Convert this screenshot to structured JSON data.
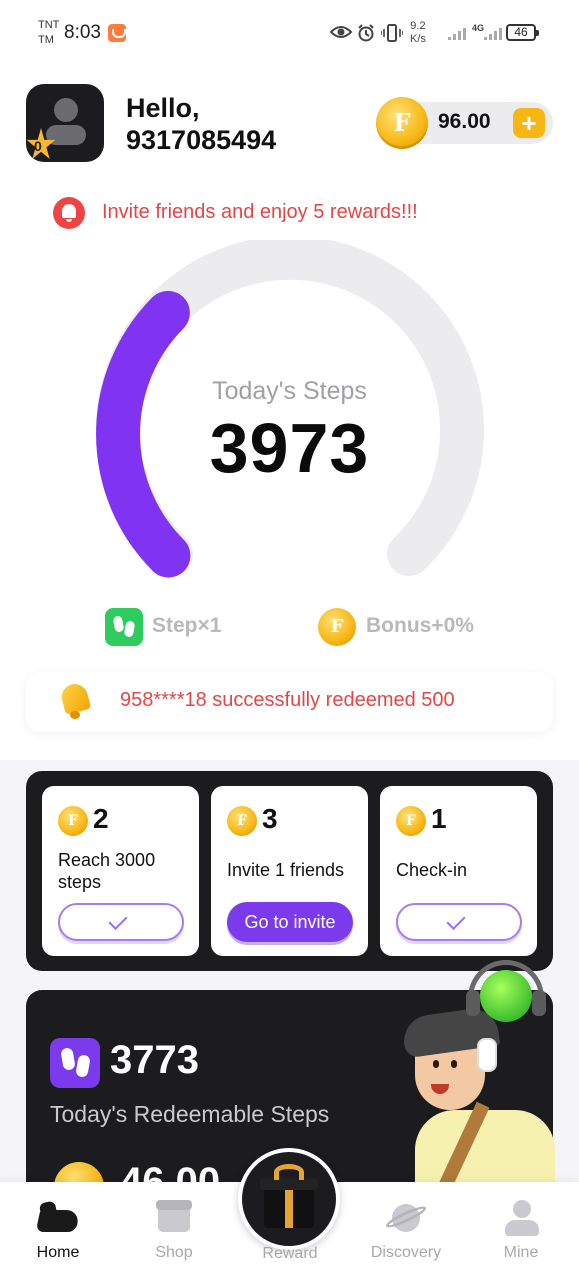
{
  "status_bar": {
    "carrier_top": "TNT",
    "carrier_bottom": "TM",
    "time": "8:03",
    "net_speed_value": "9.2",
    "net_speed_unit": "K/s",
    "network_type": "4G",
    "battery": "46"
  },
  "header": {
    "level": "0",
    "greeting": "Hello,",
    "user_id": "9317085494",
    "coin_letter": "F",
    "coin_balance": "96.00",
    "add_symbol": "+"
  },
  "invite_banner": {
    "text": "Invite friends and enjoy 5 rewards!!!"
  },
  "steps": {
    "label": "Today's Steps",
    "value": "3973",
    "ring_progress_fraction": 0.33,
    "ring_color": "#8133f2",
    "track_color": "#ececef"
  },
  "multipliers": {
    "step_label": "Step×1",
    "bonus_label": "Bonus+0%",
    "step_icon_color": "#2ecc5e"
  },
  "ticker": {
    "text": "958****18 successfully redeemed 500"
  },
  "tasks": [
    {
      "reward": "2",
      "title": "Reach 3000 steps",
      "status": "done"
    },
    {
      "reward": "3",
      "title": "Invite 1 friends",
      "status": "action",
      "button_label": "Go to invite"
    },
    {
      "reward": "1",
      "title": "Check-in",
      "status": "done"
    }
  ],
  "redeemable": {
    "steps": "3773",
    "label": "Today's Redeemable Steps",
    "coin_value_partial": "46.00"
  },
  "bottom_nav": {
    "items": [
      {
        "label": "Home",
        "icon": "shoe-icon",
        "active": true
      },
      {
        "label": "Shop",
        "icon": "shop-icon",
        "active": false
      },
      {
        "label": "Reward",
        "icon": "gift-icon",
        "active": false
      },
      {
        "label": "Discovery",
        "icon": "planet-icon",
        "active": false
      },
      {
        "label": "Mine",
        "icon": "person-icon",
        "active": false
      }
    ]
  },
  "colors": {
    "accent_purple": "#7c3aed",
    "alert_red": "#e64545",
    "coin_gold": "#f7b614",
    "dark_panel": "#1c1c1e"
  }
}
